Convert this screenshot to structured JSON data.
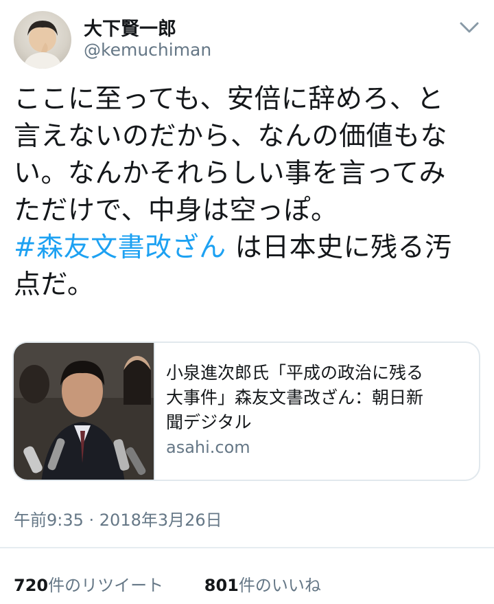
{
  "user": {
    "display_name": "大下賢一郎",
    "handle": "@kemuchiman"
  },
  "tweet": {
    "lines": [
      "ここに至っても、安倍に辞めろ、と",
      "言えないのだから、なんの価値もな",
      "い。なんかそれらしい事を言ってみ",
      "ただけで、中身は空っぽ。"
    ],
    "hashtag": "#森友文書改ざん",
    "after_hashtag": " は日本史に残る汚",
    "last_line": "点だ。"
  },
  "card": {
    "title_lines": [
      "小泉進次郎氏「平成の政治に残る",
      "大事件」森友文書改ざん：朝日新",
      "聞デジタル"
    ],
    "domain": "asahi.com"
  },
  "timestamp": "午前9:35 · 2018年3月26日",
  "stats": {
    "retweets_count": "720",
    "retweets_label": "件のリツイート",
    "likes_count": "801",
    "likes_label": "件のいいね"
  },
  "colors": {
    "link": "#1da1f2",
    "secondary_text": "#657786",
    "border": "#e1e8ed"
  },
  "icons": {
    "menu": "chevron-down-icon"
  }
}
